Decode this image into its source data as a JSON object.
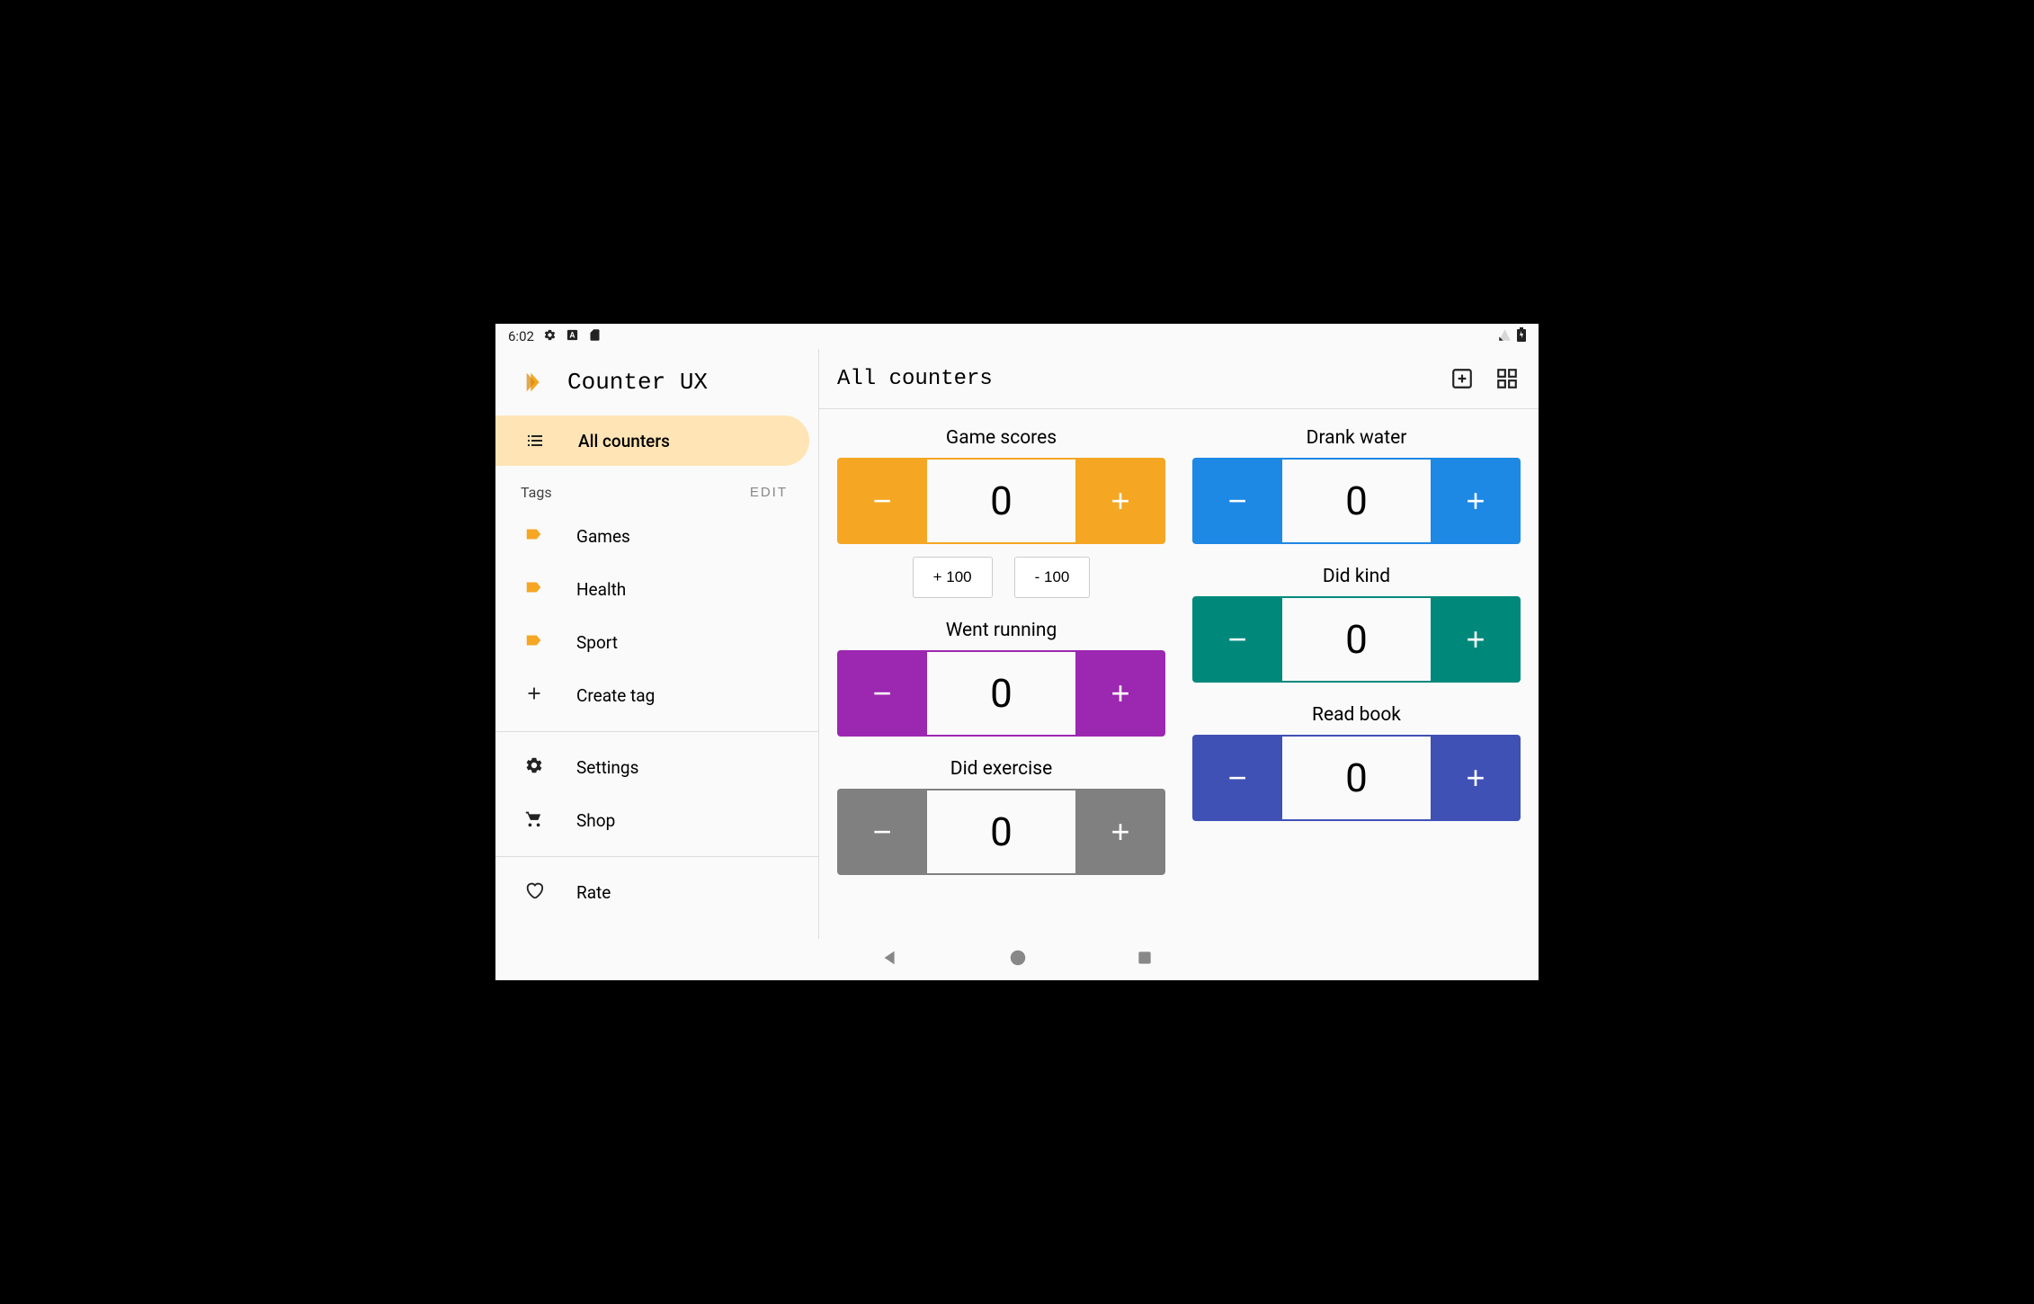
{
  "status": {
    "time": "6:02"
  },
  "app": {
    "title": "Counter UX"
  },
  "sidebar": {
    "all_counters": "All counters",
    "tags_label": "Tags",
    "edit_label": "EDIT",
    "tags": [
      {
        "label": "Games"
      },
      {
        "label": "Health"
      },
      {
        "label": "Sport"
      }
    ],
    "create_tag": "Create tag",
    "settings": "Settings",
    "shop": "Shop",
    "rate": "Rate"
  },
  "header": {
    "title": "All counters"
  },
  "colors": {
    "orange": "#f5a623",
    "blue": "#1e88e5",
    "purple": "#9c27b0",
    "teal": "#00897b",
    "grey": "#808080",
    "indigo": "#3f51b5"
  },
  "counters_left": [
    {
      "title": "Game scores",
      "value": "0",
      "color": "orange",
      "quick": [
        "+ 100",
        "- 100"
      ]
    },
    {
      "title": "Went running",
      "value": "0",
      "color": "purple"
    },
    {
      "title": "Did exercise",
      "value": "0",
      "color": "grey"
    }
  ],
  "counters_right": [
    {
      "title": "Drank water",
      "value": "0",
      "color": "blue"
    },
    {
      "title": "Did kind",
      "value": "0",
      "color": "teal"
    },
    {
      "title": "Read book",
      "value": "0",
      "color": "indigo"
    }
  ]
}
